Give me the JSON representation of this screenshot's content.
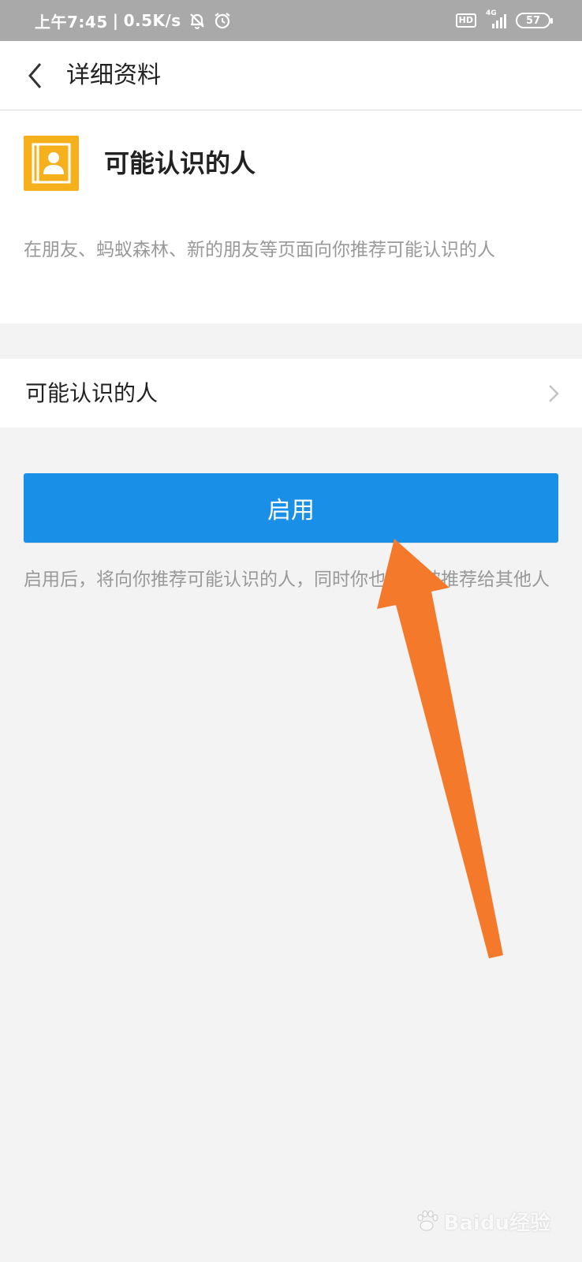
{
  "status_bar": {
    "time": "上午7:45",
    "separator": "|",
    "net_speed": "0.5K/s",
    "hd_badge": "HD",
    "network": "4G",
    "battery": "57",
    "icons": [
      "bell-off-icon",
      "alarm-icon",
      "signal-icon",
      "battery-icon"
    ]
  },
  "nav": {
    "title": "详细资料",
    "back_icon": "chevron-left-icon"
  },
  "header": {
    "icon": "contacts-book-icon",
    "icon_color": "#f6b01b",
    "title": "可能认识的人",
    "description": "在朋友、蚂蚁森林、新的朋友等页面向你推荐可能认识的人"
  },
  "settings_row": {
    "label": "可能认识的人",
    "chevron_icon": "chevron-right-icon"
  },
  "enable_button": {
    "label": "启用",
    "color": "#1a8fe8"
  },
  "enable_note": "启用后，将向你推荐可能认识的人，同时你也可能被推荐给其他人",
  "annotation": {
    "arrow_color": "#f5792a"
  },
  "watermark": {
    "text": "Baidu经验"
  }
}
